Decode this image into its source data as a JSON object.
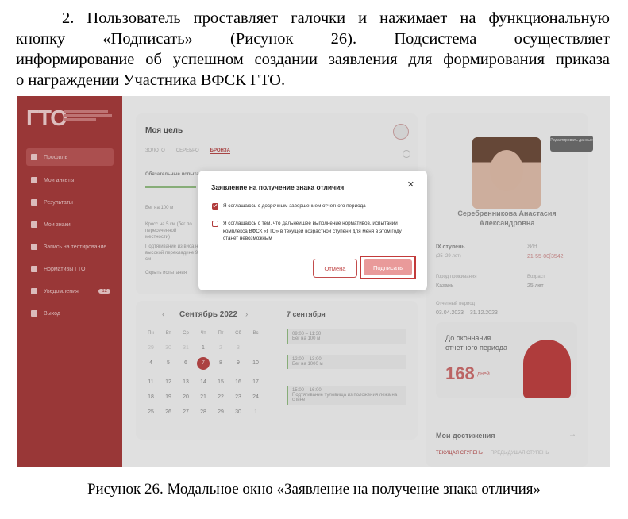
{
  "document": {
    "paragraph_lines": [
      "2. Пользователь проставляет галочки и нажимает на функциональную",
      "кнопку «Подписать» (Рисунок 26). Подсистема осуществляет",
      "информирование об успешном создании заявления для формирования приказа",
      "о награждении Участника ВФСК ГТО."
    ],
    "caption": "Рисунок 26. Модальное окно «Заявление на получение знака отличия»"
  },
  "app": {
    "logo": "ГТО",
    "sidebar": [
      {
        "label": "Профиль",
        "icon": "user-icon"
      },
      {
        "label": "Мои анкеты",
        "icon": "document-icon"
      },
      {
        "label": "Результаты",
        "icon": "chart-icon"
      },
      {
        "label": "Мои знаки",
        "icon": "medal-icon"
      },
      {
        "label": "Запись на тестирование",
        "icon": "calendar-icon"
      },
      {
        "label": "Нормативы ГТО",
        "icon": "trophy-icon"
      },
      {
        "label": "Уведомления",
        "icon": "bell-icon",
        "badge": "12"
      },
      {
        "label": "Выход",
        "icon": "logout-icon"
      }
    ],
    "goal": {
      "title": "Моя цель",
      "tabs": [
        "ЗОЛОТО",
        "СЕРЕБРО",
        "БРОНЗА"
      ],
      "required": "Обязательные испытания",
      "items": [
        "Бег на 100 м",
        "Кросс на 5 км (бег по пересеченной местности)",
        "Подтягивание из виса на высокой перекладине 90 см"
      ],
      "hide_link": "Скрыть испытания"
    },
    "calendar": {
      "month": "Сентябрь 2022",
      "weekdays": [
        "Пн",
        "Вт",
        "Ср",
        "Чт",
        "Пт",
        "Сб",
        "Вс"
      ],
      "days": [
        [
          "29",
          "30",
          "31",
          "1",
          "2",
          "3",
          ""
        ],
        [
          "4",
          "5",
          "6",
          "7",
          "8",
          "9",
          "10"
        ],
        [
          "11",
          "12",
          "13",
          "14",
          "15",
          "16",
          "17"
        ],
        [
          "18",
          "19",
          "20",
          "21",
          "22",
          "23",
          "24"
        ],
        [
          "25",
          "26",
          "27",
          "28",
          "29",
          "30",
          "1"
        ]
      ],
      "selected_day": "7 сентября",
      "events": [
        {
          "time": "09:00 – 11:30",
          "title": "Бег на 100 м"
        },
        {
          "time": "12:00 – 13:00",
          "title": "Бег на 1000 м"
        },
        {
          "time": "15:00 – 16:00",
          "title": "Подтягивание туловища из положения лежа на спине"
        }
      ]
    },
    "profile": {
      "edit_button": "Редактировать данные",
      "name": "Серебренникова Анастасия Александровна",
      "stage_label": "IX ступень",
      "stage_age": "(25–29 лет)",
      "uin_label": "УИН",
      "uin": "21-55-00[3542",
      "city_label": "Город проживания",
      "city": "Казань",
      "age_label": "Возраст",
      "age": "25 лет",
      "period_label": "Отчетный период",
      "period": "03.04.2023 – 31.12.2023",
      "promo_text": "До окончания отчетного периода",
      "promo_number": "168",
      "promo_unit": "дней",
      "achievements": "Мои достижения",
      "ach_tabs": [
        "ТЕКУЩАЯ СТУПЕНЬ",
        "ПРЕДЫДУЩАЯ СТУПЕНЬ"
      ]
    }
  },
  "modal": {
    "title": "Заявление на получение знака отличия",
    "checkbox1": {
      "label": "Я соглашаюсь с досрочным завершением отчетного периода",
      "checked": true
    },
    "checkbox2": {
      "label": "Я соглашаюсь с тем, что дальнейшее выполнение нормативов, испытаний комплекса ВФСК «ГТО» в текущей возрастной ступени для меня в этом году станет невозможным",
      "checked": false
    },
    "cancel": "Отмена",
    "sign": "Подписать"
  },
  "colors": {
    "brand": "#a23a3a",
    "accent_red": "#c24b4b",
    "success": "#8fb77f"
  }
}
